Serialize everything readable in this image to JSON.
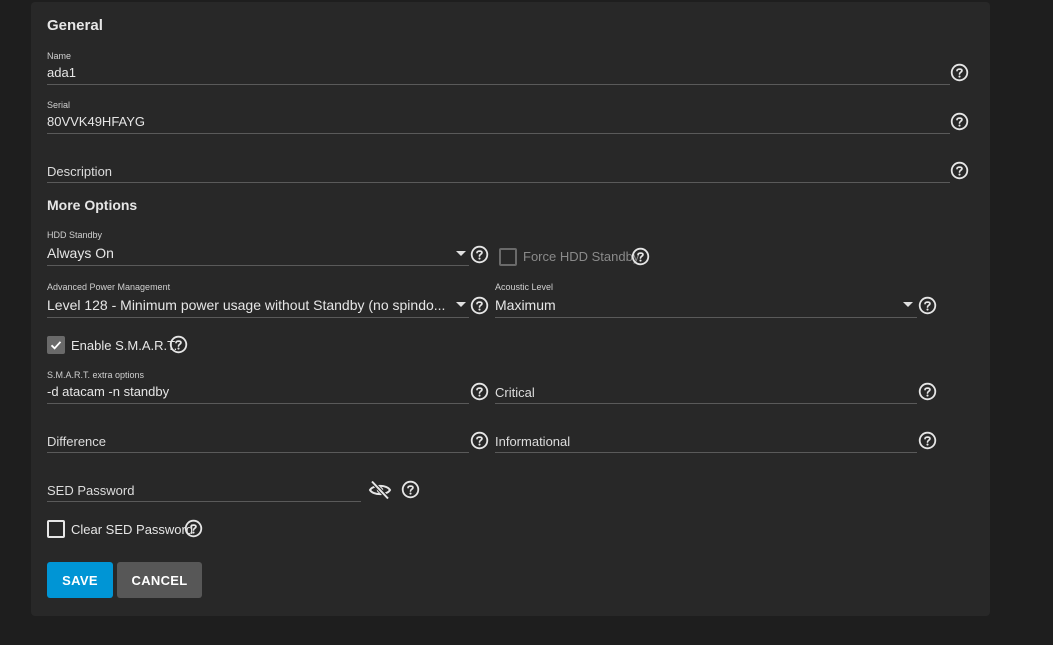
{
  "sections": {
    "general_title": "General",
    "more_options_title": "More Options"
  },
  "fields": {
    "name": {
      "label": "Name",
      "value": "ada1"
    },
    "serial": {
      "label": "Serial",
      "value": "80VVK49HFAYG"
    },
    "description": {
      "placeholder": "Description"
    },
    "hdd_standby": {
      "label": "HDD Standby",
      "value": "Always On"
    },
    "force_hdd_standby": {
      "label": "Force HDD Standby",
      "checked": false,
      "disabled": true
    },
    "apm": {
      "label": "Advanced Power Management",
      "value": "Level 128 - Minimum power usage without Standby (no spindo..."
    },
    "acoustic": {
      "label": "Acoustic Level",
      "value": "Maximum"
    },
    "enable_smart": {
      "label": "Enable S.M.A.R.T.",
      "checked": true
    },
    "smart_extra": {
      "label": "S.M.A.R.T. extra options",
      "value": "-d atacam -n standby"
    },
    "critical": {
      "placeholder": "Critical"
    },
    "difference": {
      "placeholder": "Difference"
    },
    "informational": {
      "placeholder": "Informational"
    },
    "sed_password": {
      "placeholder": "SED Password"
    },
    "clear_sed_password": {
      "label": "Clear SED Password",
      "checked": false
    }
  },
  "buttons": {
    "save": "SAVE",
    "cancel": "CANCEL"
  },
  "colors": {
    "background": "#1e1e1e",
    "card": "#282828",
    "primary": "#0095d5",
    "secondary": "#575757"
  },
  "icons": {
    "help": "help-circle-icon",
    "dropdown": "caret-down-icon",
    "visibility": "eye-off-icon",
    "check": "check-icon"
  }
}
